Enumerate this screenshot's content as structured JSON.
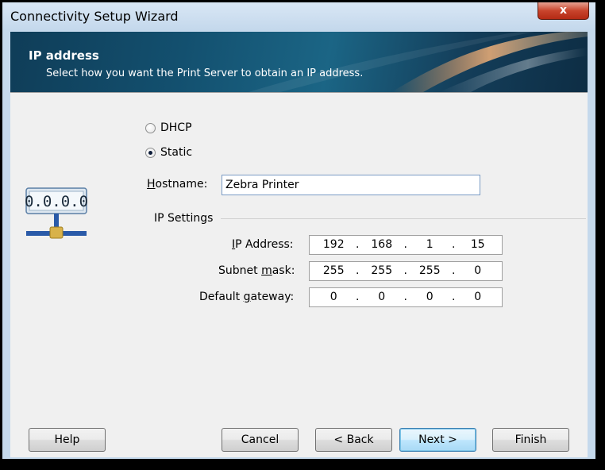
{
  "window": {
    "title": "Connectivity Setup Wizard",
    "close_symbol": "x"
  },
  "banner": {
    "title": "IP address",
    "subtitle": "Select how you want the Print Server to obtain an IP address."
  },
  "mode": {
    "options": [
      {
        "label": "DHCP",
        "checked": false
      },
      {
        "label": "Static",
        "checked": true
      }
    ]
  },
  "hostname": {
    "label_access_key": "H",
    "label_rest": "ostname:",
    "value": "Zebra Printer"
  },
  "ip_settings": {
    "group_label": "IP Settings",
    "ip_address": {
      "label_before": "",
      "label_access_key": "I",
      "label_after": "P Address:",
      "octets": [
        "192",
        "168",
        "1",
        "15"
      ]
    },
    "subnet_mask": {
      "label_before": "Subnet ",
      "label_access_key": "m",
      "label_after": "ask:",
      "octets": [
        "255",
        "255",
        "255",
        "0"
      ]
    },
    "default_gateway": {
      "label_before": "Default ",
      "label_access_key": "g",
      "label_after": "ateway:",
      "octets": [
        "0",
        "0",
        "0",
        "0"
      ]
    },
    "octet_separator": "."
  },
  "icon": {
    "name": "network-ip-icon",
    "display": "0.0.0.0"
  },
  "buttons": {
    "help": "Help",
    "cancel": "Cancel",
    "back": "< Back",
    "next": "Next >",
    "finish": "Finish"
  }
}
